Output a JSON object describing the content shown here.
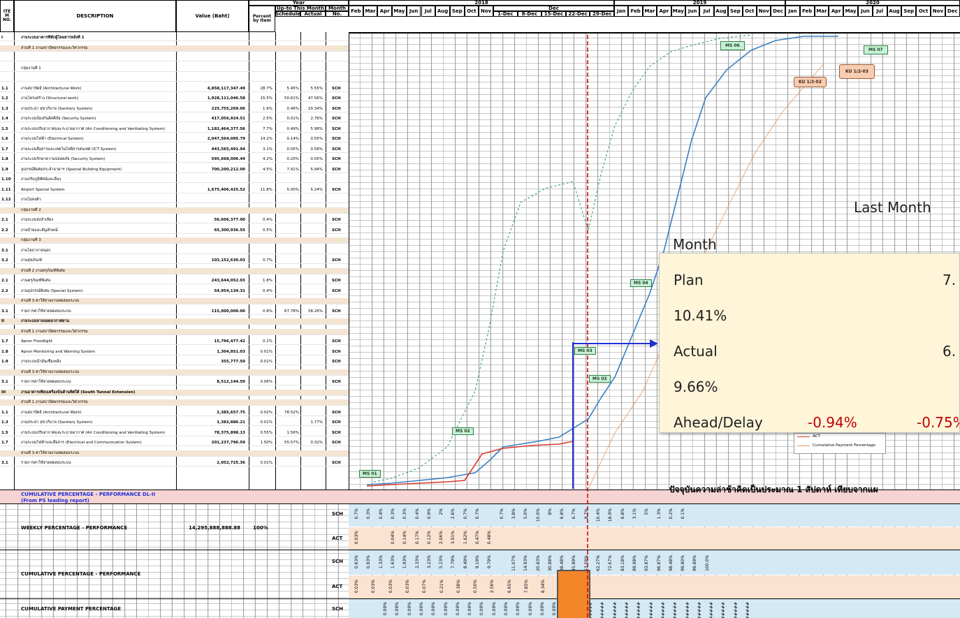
{
  "header": {
    "item_no": "ITE M NO.",
    "description": "DESCRIPTION",
    "value": "Value (Baht)",
    "percent": "Percent by Item",
    "year": "Year",
    "mtd": "Up-to This Month",
    "schedule": "Schedule",
    "actual": "Actual",
    "month": "Month",
    "no": "No.",
    "year_2018": "2018",
    "year_2019": "2019",
    "year_2020": "2020",
    "months_2018": [
      "Feb",
      "Mar",
      "Apr",
      "May",
      "Jun",
      "Jul",
      "Aug",
      "Sep",
      "Oct",
      "Nov"
    ],
    "dec": "Dec",
    "dec_weeks": [
      "1-Dec",
      "8-Dec",
      "15-Dec",
      "22-Dec",
      "29-Dec"
    ],
    "months_2019": [
      "Jan",
      "Feb",
      "Mar",
      "Apr",
      "May",
      "Jun",
      "Jul",
      "Aug",
      "Sep",
      "Oct",
      "Nov",
      "Dec"
    ],
    "months_2020": [
      "Jan",
      "Feb",
      "Mar",
      "Apr",
      "May",
      "Jun",
      "Jul",
      "Aug",
      "Sep",
      "Oct",
      "Nov",
      "Dec"
    ]
  },
  "rows": [
    {
      "no": "I",
      "desc": "งานระบบอาคารที่พักผู้โดยสารหลังที่ 1",
      "bold": true
    },
    {
      "no": "",
      "desc": "ส่วนที่ 1 งานสถาปัตยกรรมและวิศวกรรม",
      "shade": true
    },
    {
      "no": "",
      "desc": ""
    },
    {
      "no": "",
      "desc": "กลุ่มงานที่ 1"
    },
    {
      "no": "",
      "desc": ""
    },
    {
      "no": "1.1",
      "desc": "งานสถาปัตย์ (Architectural Work)",
      "val": "4,858,117,347.49",
      "pct": "28.7%",
      "sch": "5.45%",
      "act": "5.55%",
      "tag": "SCH"
    },
    {
      "no": "1.2",
      "desc": "งานโครงสร้าง (Structural work)",
      "val": "1,928,111,046.58",
      "pct": "15.5%",
      "sch": "50.61%",
      "act": "47.56%",
      "tag": "SCH"
    },
    {
      "no": "1.3",
      "desc": "งานประปา สุขาภิบาล (Sanitary System)",
      "val": "225,755,269.06",
      "pct": "1.6%",
      "sch": "0.46%",
      "act": "20.34%",
      "tag": "SCH"
    },
    {
      "no": "1.4",
      "desc": "งานระบบป้องกันอัคคีภัย (Security System)",
      "val": "417,056,924.51",
      "pct": "2.5%",
      "sch": "0.01%",
      "act": "2.76%",
      "tag": "SCH"
    },
    {
      "no": "1.5",
      "desc": "งานระบบปรับอากาศและระบายอากาศ (Air Conditioning and Ventilating System)",
      "val": "1,182,464,377.56",
      "pct": "7.7%",
      "sch": "0.49%",
      "act": "5.98%",
      "tag": "SCH"
    },
    {
      "no": "1.6",
      "desc": "งานระบบไฟฟ้า (Electrical System)",
      "val": "2,047,564,095.79",
      "pct": "14.2%",
      "sch": "0.14%",
      "act": "0.55%",
      "tag": "SCH"
    },
    {
      "no": "1.7",
      "desc": "งานระบบสื่อสารและเทคโนโลยีสารสนเทศ (ICT System)",
      "val": "443,565,491.94",
      "pct": "3.1%",
      "sch": "0.05%",
      "act": "0.58%",
      "tag": "SCH"
    },
    {
      "no": "1.8",
      "desc": "งานระบบรักษาความปลอดภัย (Security System)",
      "val": "595,668,006.44",
      "pct": "4.2%",
      "sch": "0.20%",
      "act": "0.05%",
      "tag": "SCH"
    },
    {
      "no": "1.9",
      "desc": "อุปกรณ์พิเศษประจำอาคาร (Special Building Equipment)",
      "val": "700,200,212.00",
      "pct": "4.5%",
      "sch": "7.91%",
      "act": "5.94%",
      "tag": "SCH"
    },
    {
      "no": "1.10",
      "desc": "งานปรับภูมิทัศน์และอื่นๆ"
    },
    {
      "no": "1.11",
      "desc": "Airport Special System",
      "val": "1,675,406,425.52",
      "pct": "11.8%",
      "sch": "5.00%",
      "act": "5.24%",
      "tag": "SCH"
    },
    {
      "no": "1.12",
      "desc": "งานไม่ลงตัว"
    },
    {
      "no": "",
      "desc": "กลุ่มงานที่ 2",
      "shade": true
    },
    {
      "no": "2.1",
      "desc": "งานระบบส่งลำเลียง",
      "val": "56,606,377.00",
      "pct": "0.4%",
      "tag": "SCH"
    },
    {
      "no": "2.2",
      "desc": "งานป้ายและสัญลักษณ์",
      "val": "65,300,936.55",
      "pct": "0.5%",
      "tag": "SCH"
    },
    {
      "no": "",
      "desc": "กลุ่มงานที่ 3",
      "shade": true
    },
    {
      "no": "3.1",
      "desc": "งานโยธาภายนอก"
    },
    {
      "no": "3.2",
      "desc": "งานสุขภัณฑ์",
      "val": "103,152,630.03",
      "pct": "0.7%",
      "tag": "SCH"
    },
    {
      "no": "",
      "desc": "ส่วนที่ 2 งานครุภัณฑ์พิเศษ",
      "shade": true
    },
    {
      "no": "2.1",
      "desc": "งานครุภัณฑ์พิเศษ",
      "val": "243,644,052.03",
      "pct": "1.8%",
      "tag": "SCH"
    },
    {
      "no": "2.2",
      "desc": "งานอุปกรณ์พิเศษ (Special System)",
      "val": "54,954,134.31",
      "pct": "0.4%",
      "tag": "SCH"
    },
    {
      "no": "",
      "desc": "ส่วนที่ 3 ค่าใช้จ่ายงานทดสอบระบบ",
      "shade": true
    },
    {
      "no": "3.1",
      "desc": "รายการค่าใช้จ่ายทดสอบระบบ",
      "val": "115,000,000.00",
      "pct": "0.8%",
      "sch": "67.78%",
      "act": "58.26%",
      "tag": "SCH"
    },
    {
      "no": "II",
      "desc": "งานระบบลานจอดอากาศยาน",
      "bold": true,
      "shade": true
    },
    {
      "no": "",
      "desc": "ส่วนที่ 1 งานสถาปัตยกรรมและวิศวกรรม",
      "shade": true
    },
    {
      "no": "1.7",
      "desc": "Apron Floodlight",
      "val": "15,796,477.42",
      "pct": "0.1%",
      "tag": "SCH"
    },
    {
      "no": "1.8",
      "desc": "Apron Monitoring and Warning System",
      "val": "1,304,851.03",
      "pct": "0.01%",
      "tag": "SCH"
    },
    {
      "no": "1.9",
      "desc": "งานระบบน้ำมันเชื้อเพลิง",
      "val": "355,777.50",
      "pct": "0.01%",
      "tag": "SCH"
    },
    {
      "no": "",
      "desc": "ส่วนที่ 3 ค่าใช้จ่ายงานทดสอบระบบ",
      "shade": true
    },
    {
      "no": "3.1",
      "desc": "รายการค่าใช้จ่ายทดสอบระบบ",
      "val": "8,512,144.50",
      "pct": "0.06%",
      "tag": "SCH"
    },
    {
      "no": "III",
      "desc": "งานอาคารเทียบเครื่องบินด้านทิศใต้ (South Tunnel Extension)",
      "bold": true,
      "shade": true
    },
    {
      "no": "",
      "desc": "ส่วนที่ 1 งานสถาปัตยกรรมและวิศวกรรม",
      "shade": true
    },
    {
      "no": "1.1",
      "desc": "งานสถาปัตย์ (Architectural Work)",
      "val": "2,385,657.75",
      "pct": "0.02%",
      "sch": "78.52%",
      "tag": "SCH"
    },
    {
      "no": "1.3",
      "desc": "งานประปา สุขาภิบาล (Sanitary System)",
      "val": "1,382,886.21",
      "pct": "0.01%",
      "act": "1.77%",
      "tag": "SCH"
    },
    {
      "no": "1.5",
      "desc": "งานระบบปรับอากาศและระบายอากาศ (Air Conditioning and Ventilating System)",
      "val": "78,375,898.13",
      "pct": "0.55%",
      "sch": "1.56%",
      "tag": "SCH"
    },
    {
      "no": "1.7",
      "desc": "งานระบบไฟฟ้าและสื่อสาร (Electrical and Communication System)",
      "val": "201,237,796.59",
      "pct": "1.50%",
      "sch": "55.57%",
      "act": "0.32%",
      "tag": "SCH"
    },
    {
      "no": "",
      "desc": "ส่วนที่ 3 ค่าใช้จ่ายงานทดสอบระบบ",
      "shade": true
    },
    {
      "no": "3.1",
      "desc": "รายการค่าใช้จ่ายทดสอบระบบ",
      "val": "2,052,725.36",
      "pct": "0.01%",
      "tag": "SCH"
    }
  ],
  "summary": {
    "cum_perf_title": "CUMULATIVE PERCENTAGE - PERFORMANCE DL-II",
    "cum_perf_sub": "(From PS leading report)",
    "weekly_title": "WEEKLY PERCENTAGE  - PERFORMANCE",
    "weekly_value": "14,295,888,888.88",
    "weekly_pct": "100%",
    "cumulative_title": "CUMULATIVE PERCENTAGE - PERFORMANCE",
    "payment_title": "CUMULATIVE PAYMENT PERCENTAGE",
    "sch": "SCH",
    "act": "ACT",
    "weekly_sch": [
      "0.7%",
      "0.3%",
      "0.4%",
      "0.3%",
      "0.3%",
      "0.4%",
      "0.9%",
      "2%",
      "2.6%",
      "0.7%",
      "0.7%",
      "",
      "0.7%",
      "3.8%",
      "5.0%",
      "10.0%",
      "8%",
      "6.8%",
      "6.7%",
      "8.7%",
      "10.4%",
      "18.9%",
      "6.8%",
      "3.1%",
      "5%",
      "1.3%",
      "0.2%",
      "0.1%"
    ],
    "weekly_act": [
      "0.03%",
      "",
      "",
      "0.04%",
      "0.14%",
      "0.17%",
      "0.12%",
      "2.06%",
      "3.91%",
      "1.62%",
      "0.47%",
      "0.48%"
    ],
    "cum_sch": [
      "0.63%",
      "0.93%",
      "1.33%",
      "1.63%",
      "1.93%",
      "2.33%",
      "3.23%",
      "5.23%",
      "7.79%",
      "8.49%",
      "9.19%",
      "9.79%",
      "",
      "11.07%",
      "14.93%",
      "20.83%",
      "30.88%",
      "38.48%",
      "45.89%",
      "53.58%",
      "62.27%",
      "72.67%",
      "83.18%",
      "89.98%",
      "93.87%",
      "96.87%",
      "98.48%",
      "99.80%",
      "99.89%",
      "100.0%"
    ],
    "cum_act": [
      "0.03%",
      "0.03%",
      "0.03%",
      "0.03%",
      "0.07%",
      "0.21%",
      "0.38%",
      "0.50%",
      "2.56%",
      "6.65%",
      "7.85%",
      "8.34%",
      "8.79%",
      "9.66%"
    ],
    "pay_sch": [
      "0.09%",
      "0.09%",
      "0.09%",
      "0.09%",
      "0.09%",
      "0.09%",
      "0.09%",
      "0.09%",
      "0.09%",
      "0.09%",
      "0.09%",
      "0.09%",
      "0.09%",
      "0.09%",
      "0.09%",
      "0.09%",
      "#####",
      "#####",
      "#####",
      "#####",
      "#####",
      "#####",
      "#####",
      "#####",
      "#####",
      "#####",
      "#####",
      "#####",
      "#####",
      "#####",
      "#####"
    ]
  },
  "chart": {
    "milestones": [
      "MS 01",
      "MS 02",
      "MS 03",
      "MS 02",
      "MS 04",
      "MS 06",
      "MS 07"
    ],
    "ku": [
      "KU 1/2-03",
      "KU 1/2-02"
    ],
    "legend": [
      "ACT",
      "Cumulative Payment Percentage"
    ],
    "colors": {
      "sch": "#3a7fc1",
      "act": "#d93a2b",
      "plan_dash": "#4aa37a",
      "payment": "#e8965a",
      "cutoff": "#cc0000",
      "pointer": "#1f2fd6",
      "highlight": "#f4862a"
    }
  },
  "overlay": {
    "last_month": "Last Month",
    "month": "Month",
    "plan_label": "Plan",
    "plan_value": "10.41%",
    "plan_right": "7.",
    "actual_label": "Actual",
    "actual_value": "9.66%",
    "actual_right": "6.",
    "ahead_label": "Ahead/Delay",
    "ahead_value": "-0.94%",
    "ahead_right": "-0.75%",
    "thai_note": "ปัจจุบันความล่าช้าคิดเป็นประมาณ 1 สัปดาห์ เทียบจากแผ"
  }
}
